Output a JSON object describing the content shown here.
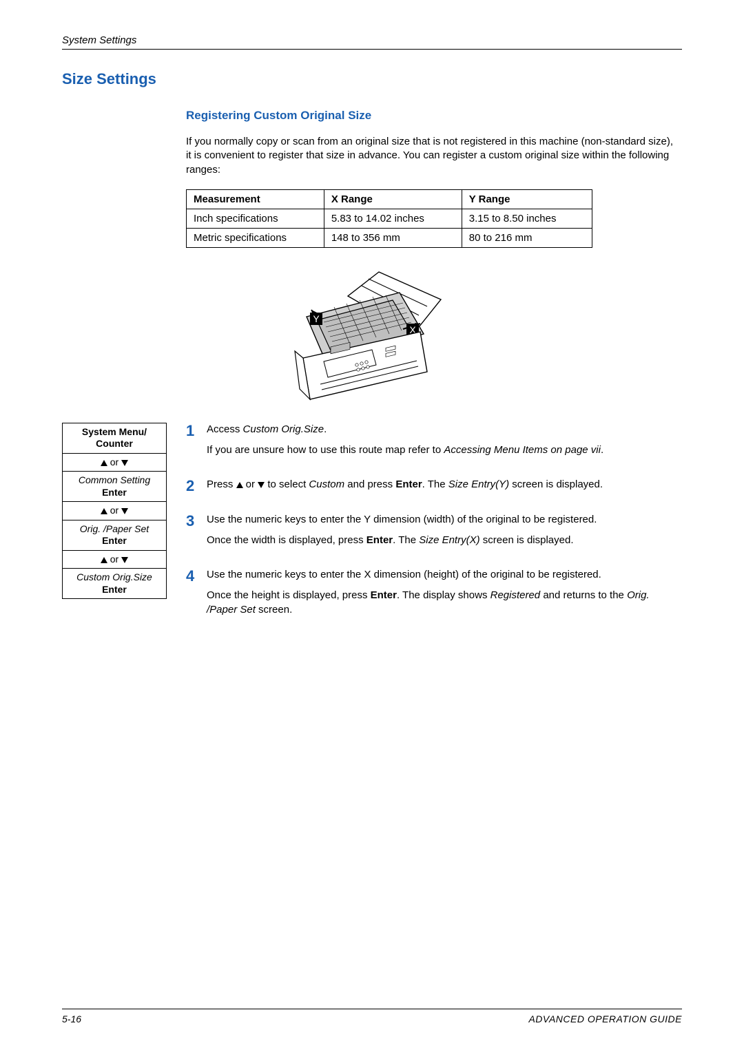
{
  "header": {
    "left": "System Settings"
  },
  "h1": "Size Settings",
  "h2": "Registering Custom Original Size",
  "intro": "If you normally copy or scan from an original size that is not registered in this machine (non-standard size), it is convenient to register that size in advance. You can register a custom original size within the following ranges:",
  "table": {
    "headers": {
      "c1": "Measurement",
      "c2": "X Range",
      "c3": "Y Range"
    },
    "rows": [
      {
        "c1": "Inch specifications",
        "c2": "5.83 to 14.02 inches",
        "c3": "3.15 to 8.50 inches"
      },
      {
        "c1": "Metric specifications",
        "c2": "148 to 356 mm",
        "c3": "80 to 216 mm"
      }
    ]
  },
  "illus": {
    "y_label": "Y",
    "x_label": "X"
  },
  "routemap": {
    "title": "System Menu/ Counter",
    "or": " or ",
    "item1": "Common Setting",
    "enter": "Enter",
    "item2": "Orig. /Paper Set",
    "item3": "Custom Orig.Size"
  },
  "steps": {
    "s1": {
      "num": "1",
      "a1": "Access ",
      "a2": "Custom Orig.Size",
      "a3": ".",
      "b1": "If you are unsure how to use this route map refer to ",
      "b2": "Accessing Menu Items on page vii",
      "b3": "."
    },
    "s2": {
      "num": "2",
      "a1": "Press ",
      "a_or": " or ",
      "a2": " to select ",
      "a3": "Custom",
      "a4": " and press ",
      "a5": "Enter",
      "a6": ". The ",
      "a7": "Size Entry(Y)",
      "a8": " screen is displayed."
    },
    "s3": {
      "num": "3",
      "a": "Use the numeric keys to enter the Y dimension (width) of the original to be registered.",
      "b1": "Once the width is displayed, press ",
      "b2": "Enter",
      "b3": ". The ",
      "b4": "Size Entry(X)",
      "b5": " screen is displayed."
    },
    "s4": {
      "num": "4",
      "a": "Use the numeric keys to enter the X dimension (height) of the original to be registered.",
      "b1": "Once the height is displayed, press ",
      "b2": "Enter",
      "b3": ". The display shows ",
      "b4": "Registered",
      "b5": " and returns to the ",
      "b6": "Orig. /Paper Set",
      "b7": " screen."
    }
  },
  "footer": {
    "left": "5-16",
    "right": "ADVANCED OPERATION GUIDE"
  }
}
